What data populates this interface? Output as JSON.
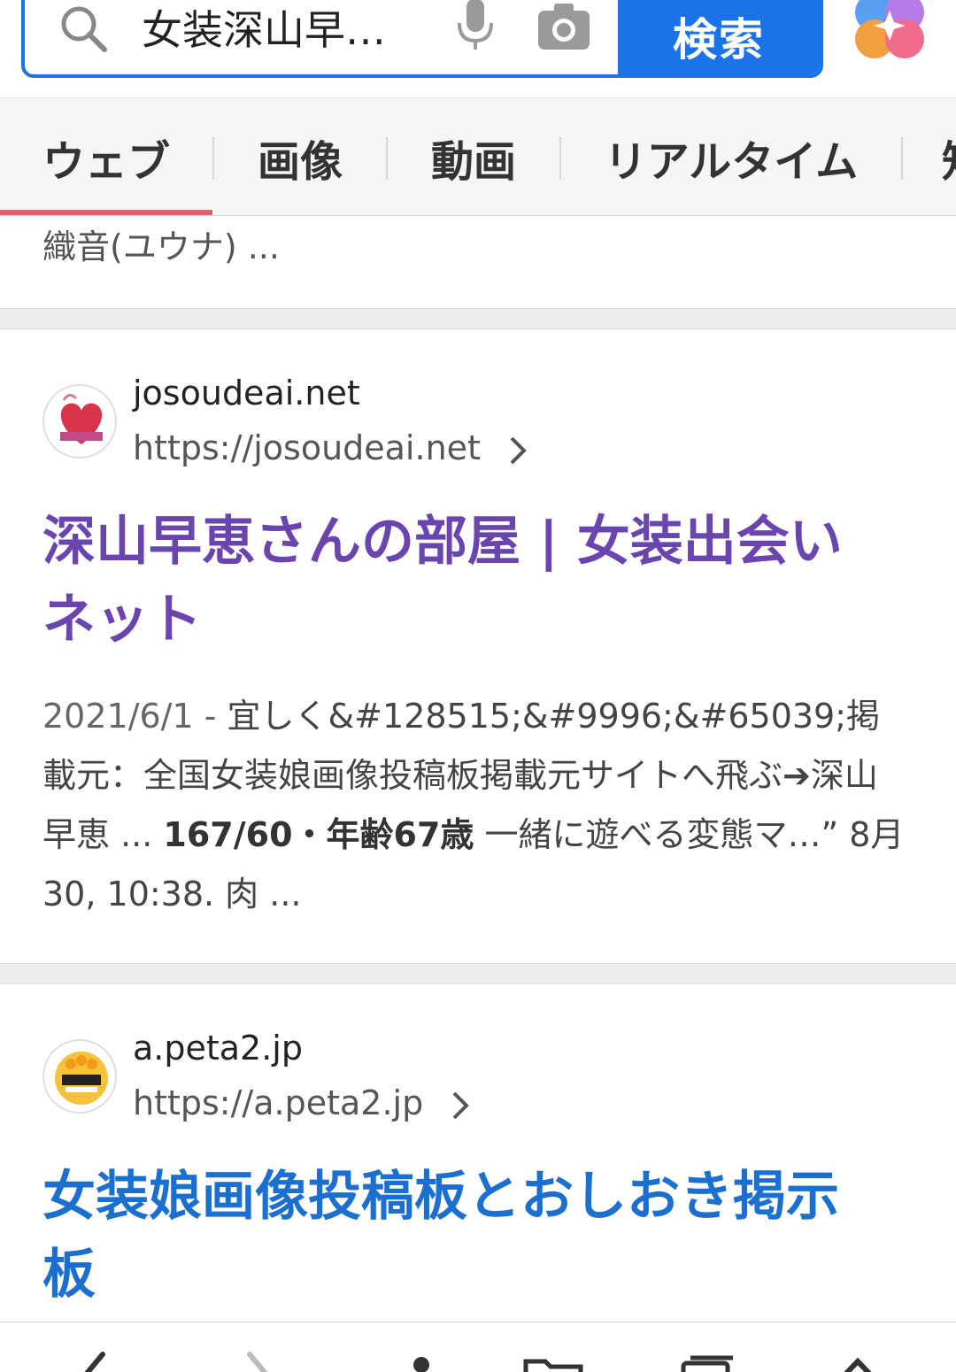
{
  "search": {
    "query": "女装深山早…",
    "button_label": "検索"
  },
  "tabs": [
    {
      "label": "ウェブ",
      "active": true
    },
    {
      "label": "画像",
      "active": false
    },
    {
      "label": "動画",
      "active": false
    },
    {
      "label": "リアルタイム",
      "active": false
    },
    {
      "label": "知",
      "active": false
    }
  ],
  "prev_snippet_tail": "織音(ユウナ) ...",
  "results": [
    {
      "domain": "josoudeai.net",
      "url": "https://josoudeai.net",
      "title_line1": "深山早恵さんの部屋 | 女装出会い",
      "title_line2": "ネット",
      "date": "2021/6/1",
      "date_sep": " - ",
      "snippet_part1": "宜しく&#128515;&#9996;&#65039;掲載元：全国女装娘画像投稿板掲載元サイトへ飛ぶ➔深山早恵 ...",
      "snippet_bold": "167/60・年齢67歳",
      "snippet_part2": "一緒に遊べる変態マ…” 8月 30, 10:38. 肉 ..."
    },
    {
      "domain": "a.peta2.jp",
      "url": "https://a.peta2.jp",
      "title_line1": "女装娘画像投稿板とおしおき掲示",
      "title_line2": "板"
    }
  ],
  "colors": {
    "accent": "#1a73e8",
    "visited_link": "#6a45b0",
    "link": "#1a6fd0",
    "tab_underline": "#e06070"
  }
}
